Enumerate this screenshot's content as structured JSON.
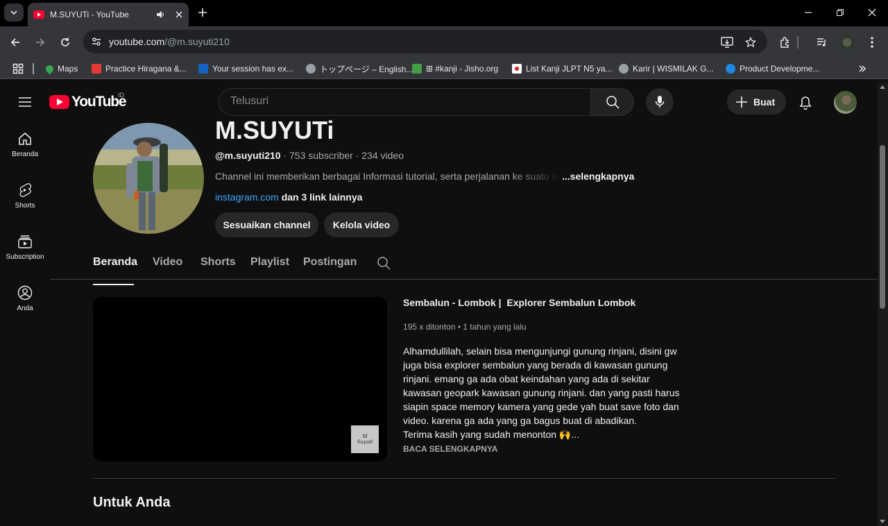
{
  "browser": {
    "tab_title": "M.SUYUTi - YouTube",
    "url_host": "youtube.com",
    "url_path": "/@m.suyuti210",
    "bookmarks": [
      {
        "label": "Maps",
        "color": "#34a853"
      },
      {
        "label": "Practice Hiragana &...",
        "color": "#e53935"
      },
      {
        "label": "Your session has ex...",
        "color": "#1565c0"
      },
      {
        "label": "トップページ – English...",
        "color": "#9aa0a6"
      },
      {
        "label": "⊞ #kanji - Jisho.org",
        "color": "#43a047"
      },
      {
        "label": "List Kanji JLPT N5 ya...",
        "color": "#ffffff"
      },
      {
        "label": "Karir | WISMILAK G...",
        "color": "#9aa0a6"
      },
      {
        "label": "Product Developme...",
        "color": "#1e88e5"
      }
    ]
  },
  "youtube": {
    "logo_text": "YouTube",
    "country_code": "ID",
    "search_placeholder": "Telusuri",
    "create_label": "Buat",
    "guide": [
      {
        "label": "Beranda",
        "icon": "home-icon"
      },
      {
        "label": "Shorts",
        "icon": "shorts-icon"
      },
      {
        "label": "Subscription",
        "icon": "subscriptions-icon"
      },
      {
        "label": "Anda",
        "icon": "you-icon"
      }
    ]
  },
  "channel": {
    "name": "M.SUYUTi",
    "handle": "@m.suyuti210",
    "stats": " · 753 subscriber · 234 video",
    "description": "Channel ini memberikan berbagai Informasi tutorial, serta perjalanan ke suatu tempat",
    "more": "...selengkapnya",
    "link": "instagram.com",
    "other_links": " dan 3 link lainnya",
    "buttons": {
      "customize": "Sesuaikan channel",
      "manage": "Kelola video"
    },
    "tabs": [
      "Beranda",
      "Video",
      "Shorts",
      "Playlist",
      "Postingan"
    ]
  },
  "featured": {
    "title": "Sembalun - Lombok |  Explorer Sembalun Lombok",
    "meta": "195 x ditonton • 1 tahun yang lalu",
    "description_lines": [
      "Alhamdullilah, selain bisa mengunjungi gunung rinjani, disini gw",
      "juga bisa explorer sembalun yang berada di kawasan gunung",
      "rinjani. emang ga ada obat keindahan yang ada di sekitar",
      "kawasan geopark kawasan gunung rinjani. dan yang pasti harus",
      "siapin space memory kamera yang gede yah buat save foto dan",
      "video. karena ga ada yang ga bagus buat di abadikan.",
      "Terima kasih yang sudah menonton 🙌..."
    ],
    "read_more": "BACA SELENGKAPNYA",
    "watermark_line1": "M",
    "watermark_line2": "Suyuti"
  },
  "section_title": "Untuk Anda"
}
